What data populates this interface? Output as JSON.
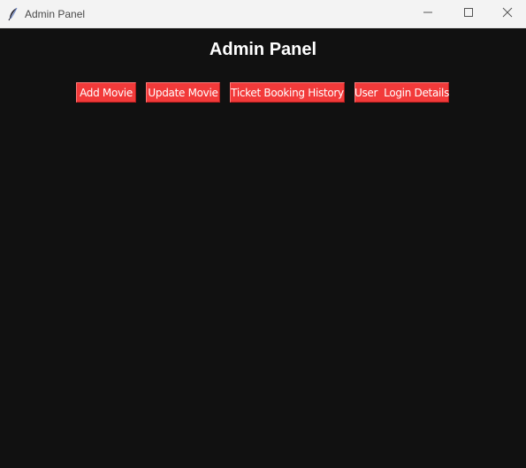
{
  "window": {
    "title": "Admin Panel",
    "app_icon": "feather-icon",
    "controls": {
      "minimize_icon": "minimize-icon",
      "maximize_icon": "maximize-icon",
      "close_icon": "close-icon"
    }
  },
  "main": {
    "heading": "Admin Panel",
    "buttons": [
      {
        "label": "Add Movie"
      },
      {
        "label": "Update Movie"
      },
      {
        "label": "Ticket Booking History"
      },
      {
        "label": "User  Login Details"
      }
    ]
  },
  "colors": {
    "background": "#111111",
    "button_red": "#f23a3a",
    "titlebar": "#f3f3f3",
    "heading_text": "#ffffff"
  }
}
